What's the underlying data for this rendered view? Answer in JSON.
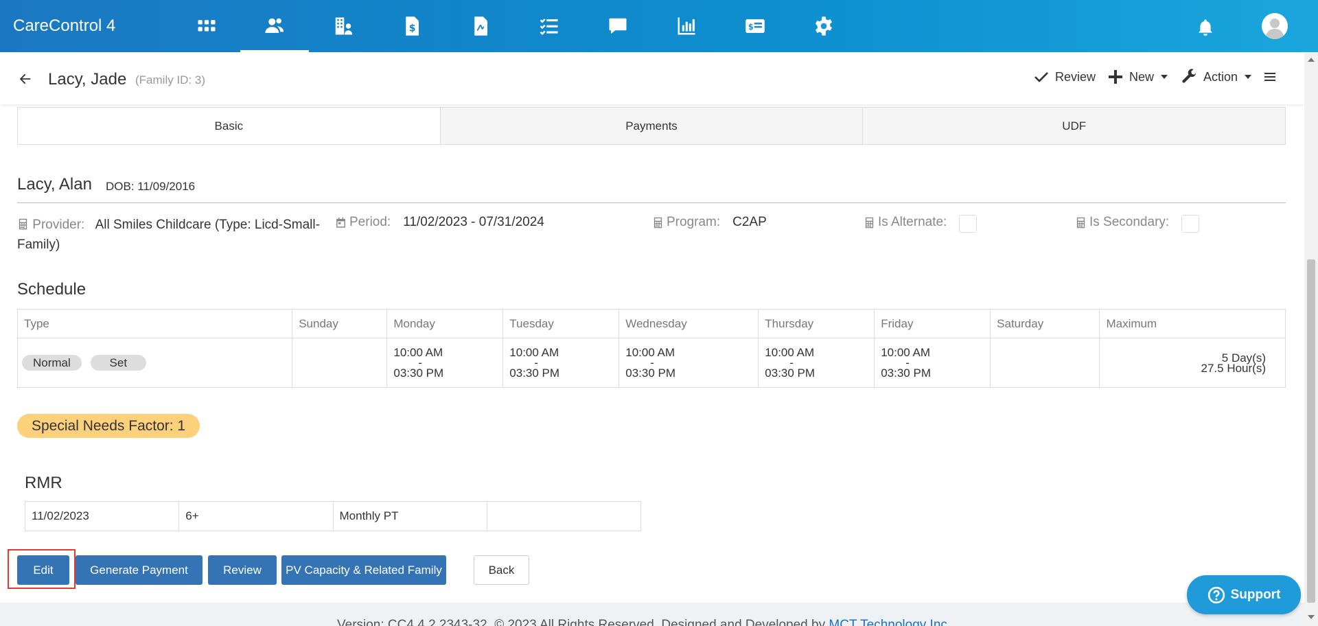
{
  "app": {
    "title": "CareControl 4",
    "nav": [
      "apps-icon",
      "families-icon",
      "providers-icon",
      "invoice-icon",
      "documents-icon",
      "tasks-icon",
      "messages-icon",
      "reports-icon",
      "billing-icon",
      "settings-icon"
    ],
    "active_nav": "families-icon"
  },
  "header": {
    "family_name": "Lacy, Jade",
    "family_id": "(Family ID: 3)",
    "review_label": "Review",
    "new_label": "New",
    "action_label": "Action"
  },
  "tabs": [
    "Basic",
    "Payments",
    "UDF"
  ],
  "child": {
    "name": "Lacy, Alan",
    "dob": "DOB: 11/09/2016",
    "provider_label": "Provider:",
    "provider_value": "All Smiles Childcare (Type: Licd-Small-Family)",
    "period_label": "Period:",
    "period_value": "11/02/2023 - 07/31/2024",
    "program_label": "Program:",
    "program_value": "C2AP",
    "alternate_label": "Is Alternate:",
    "secondary_label": "Is Secondary:"
  },
  "schedule": {
    "title": "Schedule",
    "columns": [
      "Type",
      "Sunday",
      "Monday",
      "Tuesday",
      "Wednesday",
      "Thursday",
      "Friday",
      "Saturday",
      "Maximum"
    ],
    "type_pills": [
      "Normal",
      "Set"
    ],
    "days": {
      "monday": {
        "start": "10:00 AM",
        "sep": "-",
        "end": "03:30 PM"
      },
      "tuesday": {
        "start": "10:00 AM",
        "sep": "-",
        "end": "03:30 PM"
      },
      "wednesday": {
        "start": "10:00 AM",
        "sep": "-",
        "end": "03:30 PM"
      },
      "thursday": {
        "start": "10:00 AM",
        "sep": "-",
        "end": "03:30 PM"
      },
      "friday": {
        "start": "10:00 AM",
        "sep": "-",
        "end": "03:30 PM"
      }
    },
    "max_days": "5 Day(s)",
    "max_hours": "27.5 Hour(s)"
  },
  "special_needs": "Special Needs Factor: 1",
  "rmr": {
    "title": "RMR",
    "row": [
      "11/02/2023",
      "6+",
      "Monthly PT",
      ""
    ]
  },
  "buttons": {
    "edit": "Edit",
    "generate_payment": "Generate Payment",
    "review": "Review",
    "pv_capacity": "PV Capacity & Related Family",
    "back": "Back"
  },
  "footer": {
    "text": "Version: CC4.4.2.2343-32. © 2023 All Rights Reserved. Designed and Developed by ",
    "link": "MCT Technology Inc."
  },
  "support": {
    "label": "Support"
  },
  "colors": {
    "nav_bg": "#1a78c2",
    "primary_button": "#3473b4",
    "badge": "#fdd07b",
    "highlight": "#e53935",
    "support": "#1f9bd9"
  }
}
